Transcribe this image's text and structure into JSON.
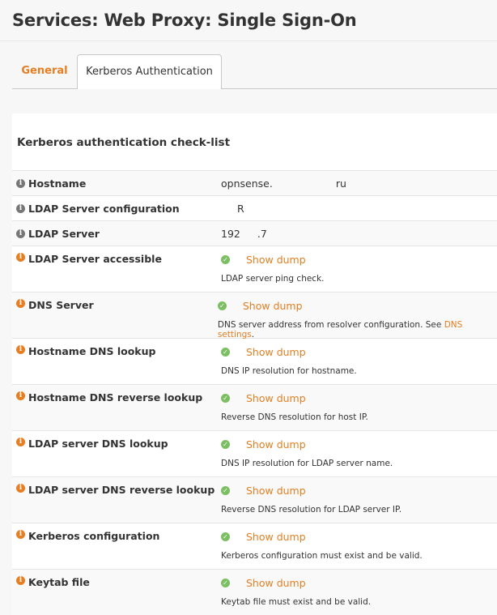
{
  "header": {
    "title": "Services: Web Proxy: Single Sign-On"
  },
  "tabs": [
    {
      "label": "General"
    },
    {
      "label": "Kerberos Authentication"
    }
  ],
  "checklist": {
    "title": "Kerberos authentication check-list",
    "show_dump_label": "Show dump",
    "static_rows": [
      {
        "label": "Hostname",
        "value_a": "opnsense.",
        "value_b": "ru"
      },
      {
        "label": "LDAP Server configuration",
        "value_a": "R"
      },
      {
        "label": "LDAP Server",
        "value_a": "192",
        "value_b": ".7"
      }
    ],
    "checks": [
      {
        "label": "LDAP Server accessible",
        "help": "LDAP server ping check."
      },
      {
        "label": "DNS Server",
        "help": "DNS server address from resolver configuration. See ",
        "link": "DNS settings",
        "help_suffix": "."
      },
      {
        "label": "Hostname DNS lookup",
        "help": "DNS IP resolution for hostname."
      },
      {
        "label": "Hostname DNS reverse lookup",
        "help": "Reverse DNS resolution for host IP."
      },
      {
        "label": "LDAP server DNS lookup",
        "help": "DNS IP resolution for LDAP server name."
      },
      {
        "label": "LDAP server DNS reverse lookup",
        "help": "Reverse DNS resolution for LDAP server IP."
      },
      {
        "label": "Kerberos configuration",
        "help": "Kerberos configuration must exist and be valid."
      },
      {
        "label": "Keytab file",
        "help": "Keytab file must exist and be valid."
      }
    ]
  },
  "colors": {
    "accent": "#e67e22",
    "success": "#7cbf62",
    "info_gray": "#777777"
  },
  "icons": {
    "info": "info-circle-icon",
    "ok": "check-circle-icon"
  }
}
